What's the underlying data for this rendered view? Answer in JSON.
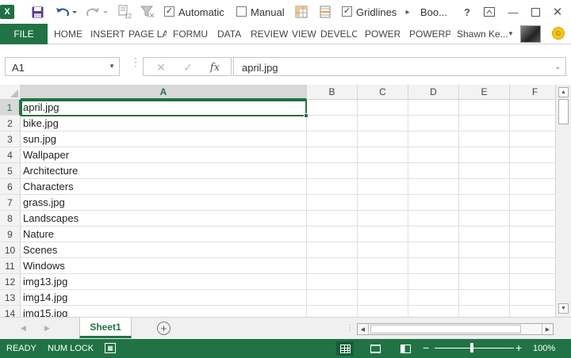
{
  "qat": {
    "logo_letter": "X",
    "automatic_label": "Automatic",
    "automatic_checked": true,
    "manual_label": "Manual",
    "manual_checked": false,
    "gridlines_label": "Gridlines",
    "gridlines_checked": true,
    "calc_badge": "12",
    "title": "Boo...",
    "help": "?"
  },
  "ribbon": {
    "file_tab": "FILE",
    "tabs": [
      "HOME",
      "INSERT",
      "PAGE LA",
      "FORMU",
      "DATA",
      "REVIEW",
      "VIEW",
      "DEVELO",
      "POWER",
      "POWERP"
    ],
    "user_name": "Shawn Ke..."
  },
  "formula_bar": {
    "name_box": "A1",
    "fx": "fx",
    "content": "april.jpg"
  },
  "grid": {
    "columns": [
      "A",
      "B",
      "C",
      "D",
      "E",
      "F"
    ],
    "active_column": "A",
    "active_row": 1,
    "rows": [
      {
        "num": "1",
        "a": "april.jpg"
      },
      {
        "num": "2",
        "a": "bike.jpg"
      },
      {
        "num": "3",
        "a": "sun.jpg"
      },
      {
        "num": "4",
        "a": "Wallpaper"
      },
      {
        "num": "5",
        "a": "Architecture"
      },
      {
        "num": "6",
        "a": "Characters"
      },
      {
        "num": "7",
        "a": "grass.jpg"
      },
      {
        "num": "8",
        "a": "Landscapes"
      },
      {
        "num": "9",
        "a": "Nature"
      },
      {
        "num": "10",
        "a": "Scenes"
      },
      {
        "num": "11",
        "a": "Windows"
      },
      {
        "num": "12",
        "a": "img13.jpg"
      },
      {
        "num": "13",
        "a": "img14.jpg"
      },
      {
        "num": "14",
        "a": "img15.jpg"
      }
    ]
  },
  "sheets": {
    "active": "Sheet1",
    "add_symbol": "+"
  },
  "status": {
    "ready": "READY",
    "num_lock": "NUM LOCK",
    "zoom": "100%"
  },
  "colors": {
    "accent": "#217346",
    "status_bg": "#217346"
  }
}
